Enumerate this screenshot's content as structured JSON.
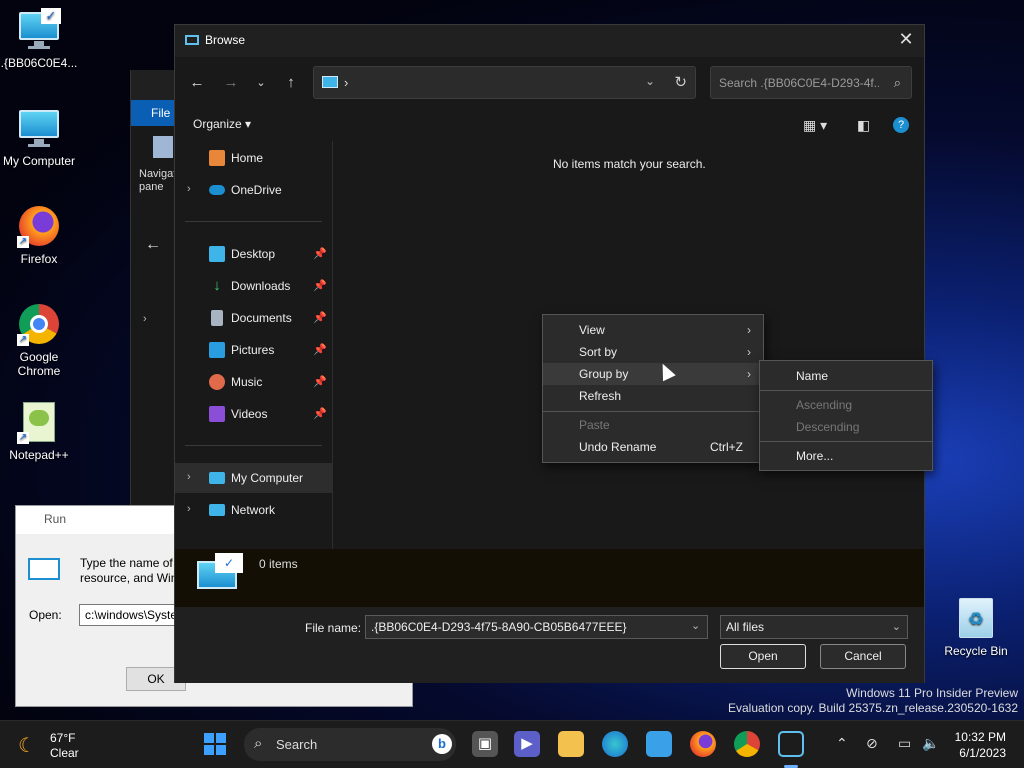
{
  "desktop": {
    "icons": [
      {
        "label": ".{BB06C0E4..."
      },
      {
        "label": "My Computer"
      },
      {
        "label": "Firefox"
      },
      {
        "label": "Google Chrome"
      },
      {
        "label": "Notepad++"
      },
      {
        "label": "Recycle Bin"
      }
    ]
  },
  "bg_explorer": {
    "ribbon_file": "File",
    "nav_pane_text": "Navigat\npane"
  },
  "run_dialog": {
    "title": "Run",
    "description_line1": "Type the name of a",
    "description_line2": "resource, and Win",
    "open_label": "Open:",
    "open_value": "c:\\windows\\Syste",
    "ok_label": "OK"
  },
  "browse": {
    "title": "Browse",
    "address_chevron": "›",
    "search_placeholder": "Search .{BB06C0E4-D293-4f...",
    "organize_label": "Organize",
    "empty_message": "No items match your search.",
    "nav_pane": {
      "items": [
        {
          "label": "Home",
          "icon": "home-icon"
        },
        {
          "label": "OneDrive",
          "icon": "onedrive-icon"
        },
        {
          "label": "Desktop",
          "icon": "desktop-folder-icon"
        },
        {
          "label": "Downloads",
          "icon": "downloads-icon"
        },
        {
          "label": "Documents",
          "icon": "documents-icon"
        },
        {
          "label": "Pictures",
          "icon": "pictures-icon"
        },
        {
          "label": "Music",
          "icon": "music-icon"
        },
        {
          "label": "Videos",
          "icon": "videos-icon"
        },
        {
          "label": "My Computer",
          "icon": "computer-icon"
        },
        {
          "label": "Network",
          "icon": "network-icon"
        }
      ]
    },
    "details": {
      "count": "0 items"
    },
    "file_name_label": "File name:",
    "file_name_value": ".{BB06C0E4-D293-4f75-8A90-CB05B6477EEE}",
    "file_type_value": "All files",
    "open_button": "Open",
    "cancel_button": "Cancel"
  },
  "context_menu": {
    "items": [
      {
        "label": "View",
        "submenu": true
      },
      {
        "label": "Sort by",
        "submenu": true
      },
      {
        "label": "Group by",
        "submenu": true
      },
      {
        "label": "Refresh"
      },
      {
        "label": "Paste",
        "disabled": true
      },
      {
        "label": "Undo Rename",
        "shortcut": "Ctrl+Z"
      }
    ]
  },
  "group_by_menu": {
    "items": [
      {
        "label": "Name"
      },
      {
        "label": "Ascending",
        "disabled": true
      },
      {
        "label": "Descending",
        "disabled": true
      },
      {
        "label": "More..."
      }
    ]
  },
  "watermark": {
    "line1": "Windows 11 Pro Insider Preview",
    "line2": "Evaluation copy. Build 25375.zn_release.230520-1632"
  },
  "taskbar": {
    "weather_temp": "67°F",
    "weather_cond": "Clear",
    "search_label": "Search",
    "time": "10:32 PM",
    "date": "6/1/2023"
  },
  "colors": {
    "accent": "#0a5fb4",
    "dialog_bg": "#191919",
    "menu_bg": "#2b2b2b"
  }
}
